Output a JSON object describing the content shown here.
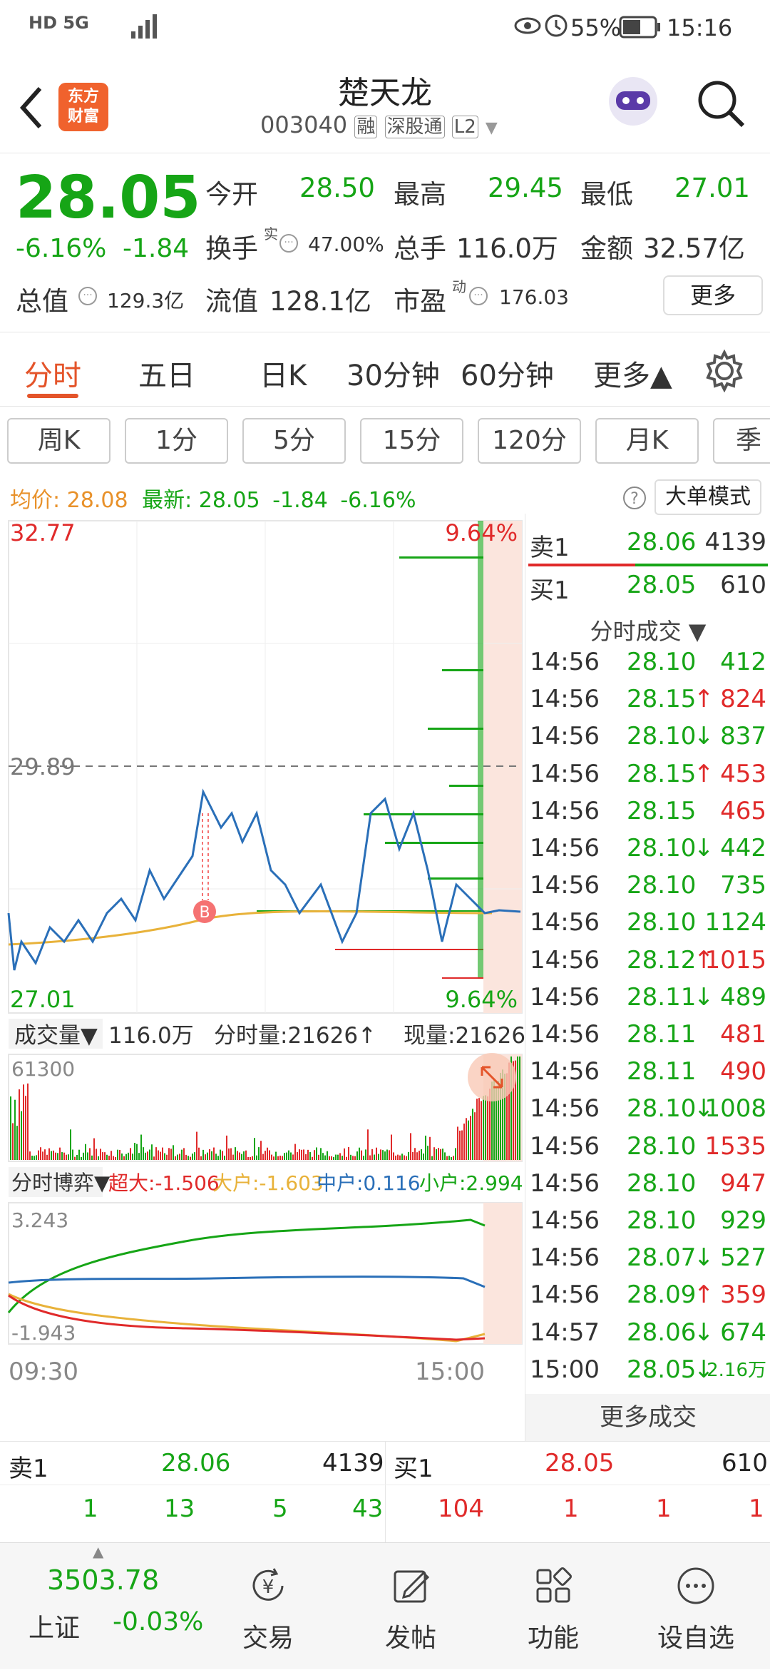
{
  "status_bar": {
    "left": "HD 5G",
    "battery": "55%",
    "time": "15:16"
  },
  "header": {
    "back_icon": "chevron-left-icon",
    "logo_line1": "东方",
    "logo_line2": "财富",
    "stock_name": "楚天龙",
    "stock_code": "003040",
    "badges": [
      "融",
      "深股通",
      "L2"
    ],
    "search_icon": "search-icon"
  },
  "quote": {
    "price": "28.05",
    "change_pct": "-6.16%",
    "change": "-1.84",
    "open_label": "今开",
    "open": "28.50",
    "high_label": "最高",
    "high": "29.45",
    "low_label": "最低",
    "low": "27.01",
    "turnover_label": "换手",
    "turnover_sup": "实",
    "turnover": "47.00%",
    "volume_label": "总手",
    "volume": "116.0万",
    "amount_label": "金额",
    "amount": "32.57亿",
    "mktcap_label": "总值",
    "mktcap": "129.3亿",
    "float_label": "流值",
    "float_cap": "128.1亿",
    "pe_label": "市盈",
    "pe_sup": "动",
    "pe": "176.03",
    "more_button": "更多"
  },
  "tabs": {
    "items": [
      "分时",
      "五日",
      "日K",
      "30分钟",
      "60分钟",
      "更多▲"
    ],
    "active": 0,
    "settings_icon": "gear-icon"
  },
  "subtabs": [
    "周K",
    "1分",
    "5分",
    "15分",
    "120分",
    "月K",
    "季"
  ],
  "legend": {
    "avg_label": "均价:",
    "avg": "28.08",
    "latest_label": "最新:",
    "latest": "28.05",
    "change": "-1.84",
    "change_pct": "-6.16%",
    "big_order_button": "大单模式"
  },
  "price_chart": {
    "max_label": "32.77",
    "mid_label": "29.89",
    "min_label": "27.01",
    "max_pct": "9.64%",
    "min_pct": "9.64%",
    "marker": "B"
  },
  "volume_bar": {
    "label": "成交量▼",
    "total": "116.0万",
    "tick_label": "分时量:21626↑",
    "now_label": "现量:21626",
    "max_label": "61300"
  },
  "game_bar": {
    "label": "分时博弈▼",
    "super": "超大:-1.506",
    "large": "大户:-1.603",
    "mid": "中户:0.116",
    "small": "小户:2.994",
    "max_label": "3.243",
    "min_label": "-1.943"
  },
  "time_axis": [
    "09:30",
    "15:00"
  ],
  "order_book_top": {
    "sell_label": "卖1",
    "sell_price": "28.06",
    "sell_vol": "4139",
    "buy_label": "买1",
    "buy_price": "28.05",
    "buy_vol": "610"
  },
  "ticks_header": "分时成交 ▼",
  "ticks": [
    {
      "t": "14:56",
      "p": "28.10",
      "a": "",
      "v": "412",
      "c": "green"
    },
    {
      "t": "14:56",
      "p": "28.15",
      "a": "↑",
      "v": "824",
      "c": "red"
    },
    {
      "t": "14:56",
      "p": "28.10",
      "a": "↓",
      "v": "837",
      "c": "green"
    },
    {
      "t": "14:56",
      "p": "28.15",
      "a": "↑",
      "v": "453",
      "c": "red"
    },
    {
      "t": "14:56",
      "p": "28.15",
      "a": "",
      "v": "465",
      "c": "red"
    },
    {
      "t": "14:56",
      "p": "28.10",
      "a": "↓",
      "v": "442",
      "c": "green"
    },
    {
      "t": "14:56",
      "p": "28.10",
      "a": "",
      "v": "735",
      "c": "green"
    },
    {
      "t": "14:56",
      "p": "28.10",
      "a": "",
      "v": "1124",
      "c": "green"
    },
    {
      "t": "14:56",
      "p": "28.12",
      "a": "↑",
      "v": "1015",
      "c": "red"
    },
    {
      "t": "14:56",
      "p": "28.11",
      "a": "↓",
      "v": "489",
      "c": "green"
    },
    {
      "t": "14:56",
      "p": "28.11",
      "a": "",
      "v": "481",
      "c": "red"
    },
    {
      "t": "14:56",
      "p": "28.11",
      "a": "",
      "v": "490",
      "c": "red"
    },
    {
      "t": "14:56",
      "p": "28.10",
      "a": "↓",
      "v": "1008",
      "c": "green"
    },
    {
      "t": "14:56",
      "p": "28.10",
      "a": "",
      "v": "1535",
      "c": "red"
    },
    {
      "t": "14:56",
      "p": "28.10",
      "a": "",
      "v": "947",
      "c": "red"
    },
    {
      "t": "14:56",
      "p": "28.10",
      "a": "",
      "v": "929",
      "c": "green"
    },
    {
      "t": "14:56",
      "p": "28.07",
      "a": "↓",
      "v": "527",
      "c": "green"
    },
    {
      "t": "14:56",
      "p": "28.09",
      "a": "↑",
      "v": "359",
      "c": "red"
    },
    {
      "t": "14:57",
      "p": "28.06",
      "a": "↓",
      "v": "674",
      "c": "green"
    },
    {
      "t": "15:00",
      "p": "28.05",
      "a": "↓",
      "v": "2.16万",
      "c": "green"
    }
  ],
  "more_ticks_button": "更多成交",
  "depth": {
    "sell_label": "卖1",
    "sell_price": "28.06",
    "sell_vol": "4139",
    "buy_label": "买1",
    "buy_price": "28.05",
    "buy_vol": "610",
    "sell_row": [
      "1",
      "13",
      "5",
      "43"
    ],
    "buy_row": [
      "104",
      "1",
      "1",
      "1"
    ]
  },
  "nav": {
    "index_value": "3503.78",
    "index_name": "上证",
    "index_change": "-0.03%",
    "items": [
      {
        "label": "交易",
        "icon": "yen-cycle-icon"
      },
      {
        "label": "发帖",
        "icon": "edit-icon"
      },
      {
        "label": "功能",
        "icon": "grid-icon"
      },
      {
        "label": "设自选",
        "icon": "more-circle-icon"
      }
    ]
  },
  "colors": {
    "up": "#e02a2a",
    "down": "#16a516",
    "accent": "#e4542a",
    "avg_line": "#e8b23a",
    "price_line": "#2a6fb8"
  }
}
